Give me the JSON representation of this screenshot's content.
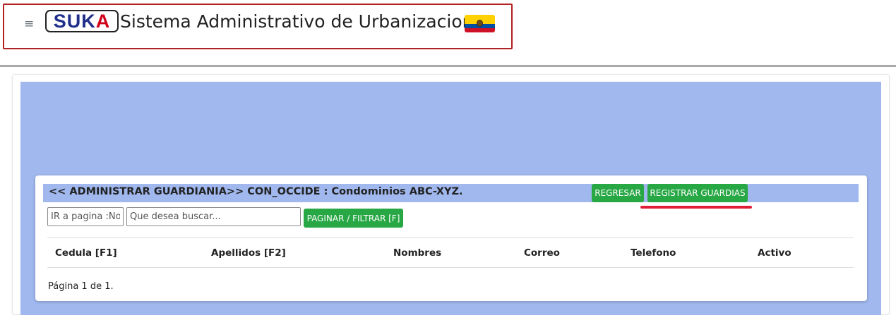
{
  "header": {
    "logo": {
      "part1": "SUK",
      "part2": "A"
    },
    "app_title": "Sistema Administrativo de Urbanizaciones",
    "menu_icon": "hamburger-icon",
    "flag_icon": "ecuador-flag-icon"
  },
  "panel": {
    "title": "<< ADMINISTRAR GUARDIANIA>> CON_OCCIDE : Condominios ABC-XYZ.",
    "buttons": {
      "regresar": "REGRESAR",
      "registrar": "REGISTRAR GUARDIAS",
      "paginar": "PAGINAR / FILTRAR [F]"
    },
    "inputs": {
      "page_placeholder": "IR a pagina :No",
      "page_value": "",
      "search_placeholder": "Que desea buscar...",
      "search_value": ""
    },
    "table": {
      "columns": [
        "Cedula [F1]",
        "Apellidos [F2]",
        "Nombres",
        "Correo",
        "Telefono",
        "Activo"
      ],
      "rows": []
    },
    "pagination": "Página 1 de 1."
  },
  "colors": {
    "panel_blue": "#a0b8ee",
    "button_green": "#28a745",
    "highlight_red": "#e01e37",
    "logo_blue": "#1f2f8a",
    "logo_red": "#d0021b"
  }
}
